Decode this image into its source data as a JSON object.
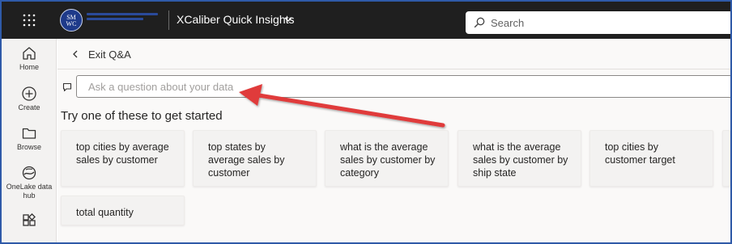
{
  "topbar": {
    "org_logo_text": "SMWC",
    "app_title": "XCaliber Quick Insights",
    "search_placeholder": "Search"
  },
  "leftnav": {
    "items": [
      {
        "label": "Home",
        "icon": "home-icon"
      },
      {
        "label": "Create",
        "icon": "plus-circle-icon"
      },
      {
        "label": "Browse",
        "icon": "folder-icon"
      },
      {
        "label": "OneLake data hub",
        "icon": "onelake-icon"
      },
      {
        "label": "",
        "icon": "apps-icon"
      }
    ]
  },
  "main": {
    "exit_label": "Exit Q&A",
    "question_placeholder": "Ask a question about your data",
    "prompt_heading": "Try one of these to get started",
    "suggestions": [
      "top cities by average sales by customer",
      "top states by average sales by customer",
      "what is the average sales by customer by category",
      "what is the average sales by customer by ship state",
      "top cities by customer target",
      "total quantity"
    ]
  },
  "colors": {
    "topbar_bg": "#1f1f1f",
    "annotation_arrow": "#e03a3a",
    "frame_border": "#2f5aa8"
  }
}
